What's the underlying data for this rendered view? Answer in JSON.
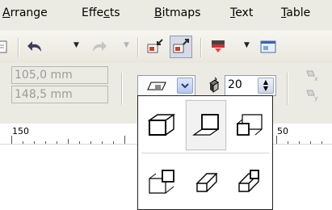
{
  "menubar": {
    "items": [
      {
        "label": "Arrange",
        "mnemonic": "A"
      },
      {
        "label": "Effects",
        "mnemonic": "c"
      },
      {
        "label": "Bitmaps",
        "mnemonic": "B"
      },
      {
        "label": "Text",
        "mnemonic": "T"
      },
      {
        "label": "Table",
        "mnemonic": "T"
      }
    ]
  },
  "toolbar": {
    "icons": [
      "page-icon",
      "undo-icon",
      "redo-icon",
      "import-icon",
      "export-icon",
      "application-launcher-icon",
      "welcome-screen-icon"
    ]
  },
  "propbar": {
    "position_x": "105,0 mm",
    "position_y": "148,5 mm",
    "depth_value": "20",
    "icons": [
      "extrude-type-icon",
      "depth-icon",
      "vanishing-point-x-icon",
      "vanishing-point-y-icon"
    ]
  },
  "ruler": {
    "labels": [
      "150",
      "50"
    ]
  },
  "extrusion_dropdown": {
    "selected_index": 1,
    "options": [
      "small-back-extrusion",
      "small-front-extrusion",
      "big-back-extrusion",
      "big-front-extrusion",
      "back-parallel-extrusion",
      "front-parallel-extrusion"
    ]
  },
  "colors": {
    "chrome": "#ecebe3",
    "highlight_border": "#8e9bb8",
    "combo_arrow": "#b7c7ee"
  }
}
